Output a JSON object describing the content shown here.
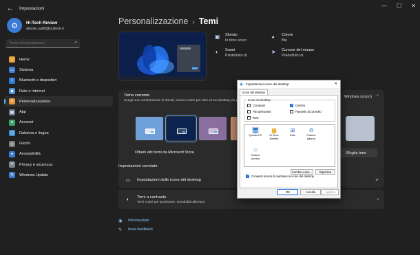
{
  "window": {
    "title": "Impostazioni"
  },
  "profile": {
    "name": "Hi-Tech Review",
    "email": "alessio.sa89@outlook.it"
  },
  "search": {
    "placeholder": "Trova un'impostazione"
  },
  "nav": {
    "items": [
      {
        "label": "Home",
        "icon": "home-icon",
        "color": "#e8a33d"
      },
      {
        "label": "Sistema",
        "icon": "system-icon",
        "color": "#3a7bd5"
      },
      {
        "label": "Bluetooth e dispositivi",
        "icon": "bluetooth-icon",
        "color": "#2f7bd8"
      },
      {
        "label": "Rete e Internet",
        "icon": "network-icon",
        "color": "#4a8fd8"
      },
      {
        "label": "Personalizzazione",
        "icon": "brush-icon",
        "color": "#e6943a"
      },
      {
        "label": "App",
        "icon": "apps-icon",
        "color": "#6a7b8c"
      },
      {
        "label": "Account",
        "icon": "account-icon",
        "color": "#3fa36b"
      },
      {
        "label": "Data/ora e lingua",
        "icon": "clock-icon",
        "color": "#3a8fd5"
      },
      {
        "label": "Giochi",
        "icon": "games-icon",
        "color": "#7a7a7a"
      },
      {
        "label": "Accessibilità",
        "icon": "accessibility-icon",
        "color": "#3a7bd5"
      },
      {
        "label": "Privacy e sicurezza",
        "icon": "shield-icon",
        "color": "#7a8593"
      },
      {
        "label": "Windows Update",
        "icon": "update-icon",
        "color": "#3a7bd5"
      }
    ],
    "active_index": 4
  },
  "breadcrumb": {
    "parent": "Personalizzazione",
    "separator": "›",
    "current": "Temi"
  },
  "properties": {
    "background": {
      "title": "Sfondo",
      "value": "In fiore scuro"
    },
    "color": {
      "title": "Colore",
      "value": "Blu"
    },
    "sounds": {
      "title": "Suoni",
      "value": "Predefinito di"
    },
    "cursor": {
      "title": "Cursore del mouse",
      "value": "Predefinito di"
    }
  },
  "current_theme": {
    "title": "Tema corrente",
    "description": "Scegli una combinazione di sfondi, suoni e colori per dare al tuo desktop più personalità",
    "value": "Windows (scuro)",
    "store_text": "Ottieni altri temi da Microsoft Store",
    "browse_button": "Sfoglia temi"
  },
  "related": {
    "title": "Impostazioni correlate",
    "desktop_icons": {
      "title": "Impostazioni delle icone del desktop"
    },
    "contrast": {
      "title": "Temi a contrasto",
      "subtitle": "Temi colori per ipovisione, sensibilità alla luce"
    }
  },
  "links": {
    "info": "Informazioni",
    "feedback": "Invia feedback"
  },
  "dialog": {
    "title": "Impostazioni icone del desktop",
    "tab": "Icone del desktop",
    "group_label": "Icone del desktop",
    "checkboxes": [
      {
        "label": "Computer",
        "checked": false
      },
      {
        "label": "Cestino",
        "checked": true
      },
      {
        "label": "File dell'utente",
        "checked": false
      },
      {
        "label": "Pannello di controllo",
        "checked": false
      },
      {
        "label": "Rete",
        "checked": false
      }
    ],
    "icons": [
      {
        "label": "Questo PC",
        "icon": "computer-icon"
      },
      {
        "label": "Hi-Tech Review",
        "icon": "folder-icon"
      },
      {
        "label": "Rete",
        "icon": "network-icon"
      },
      {
        "label": "Cestino (pieno)",
        "icon": "recycle-bin-full-icon"
      },
      {
        "label": "Cestino (vuoto)",
        "icon": "recycle-bin-empty-icon"
      }
    ],
    "change_icon_button": "Cambia icona...",
    "restore_button": "Ripristina",
    "allow_themes_label": "Consenti ai temi di cambiare le icone del desktop",
    "allow_themes_checked": true,
    "ok": "OK",
    "cancel": "Annulla",
    "apply": "Applica"
  }
}
